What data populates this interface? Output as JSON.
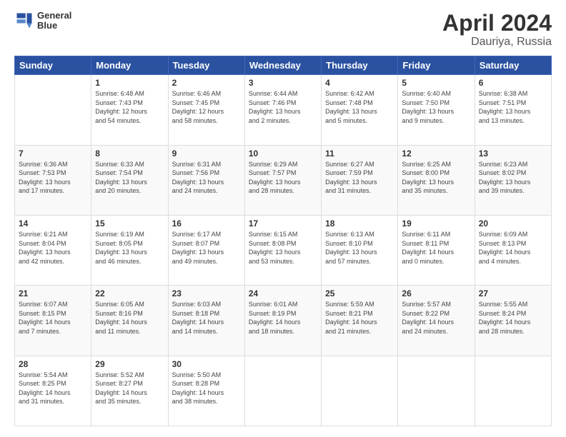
{
  "header": {
    "logo_line1": "General",
    "logo_line2": "Blue",
    "title": "April 2024",
    "subtitle": "Dauriya, Russia"
  },
  "days_of_week": [
    "Sunday",
    "Monday",
    "Tuesday",
    "Wednesday",
    "Thursday",
    "Friday",
    "Saturday"
  ],
  "weeks": [
    [
      {
        "num": "",
        "info": ""
      },
      {
        "num": "1",
        "info": "Sunrise: 6:48 AM\nSunset: 7:43 PM\nDaylight: 12 hours\nand 54 minutes."
      },
      {
        "num": "2",
        "info": "Sunrise: 6:46 AM\nSunset: 7:45 PM\nDaylight: 12 hours\nand 58 minutes."
      },
      {
        "num": "3",
        "info": "Sunrise: 6:44 AM\nSunset: 7:46 PM\nDaylight: 13 hours\nand 2 minutes."
      },
      {
        "num": "4",
        "info": "Sunrise: 6:42 AM\nSunset: 7:48 PM\nDaylight: 13 hours\nand 5 minutes."
      },
      {
        "num": "5",
        "info": "Sunrise: 6:40 AM\nSunset: 7:50 PM\nDaylight: 13 hours\nand 9 minutes."
      },
      {
        "num": "6",
        "info": "Sunrise: 6:38 AM\nSunset: 7:51 PM\nDaylight: 13 hours\nand 13 minutes."
      }
    ],
    [
      {
        "num": "7",
        "info": "Sunrise: 6:36 AM\nSunset: 7:53 PM\nDaylight: 13 hours\nand 17 minutes."
      },
      {
        "num": "8",
        "info": "Sunrise: 6:33 AM\nSunset: 7:54 PM\nDaylight: 13 hours\nand 20 minutes."
      },
      {
        "num": "9",
        "info": "Sunrise: 6:31 AM\nSunset: 7:56 PM\nDaylight: 13 hours\nand 24 minutes."
      },
      {
        "num": "10",
        "info": "Sunrise: 6:29 AM\nSunset: 7:57 PM\nDaylight: 13 hours\nand 28 minutes."
      },
      {
        "num": "11",
        "info": "Sunrise: 6:27 AM\nSunset: 7:59 PM\nDaylight: 13 hours\nand 31 minutes."
      },
      {
        "num": "12",
        "info": "Sunrise: 6:25 AM\nSunset: 8:00 PM\nDaylight: 13 hours\nand 35 minutes."
      },
      {
        "num": "13",
        "info": "Sunrise: 6:23 AM\nSunset: 8:02 PM\nDaylight: 13 hours\nand 39 minutes."
      }
    ],
    [
      {
        "num": "14",
        "info": "Sunrise: 6:21 AM\nSunset: 8:04 PM\nDaylight: 13 hours\nand 42 minutes."
      },
      {
        "num": "15",
        "info": "Sunrise: 6:19 AM\nSunset: 8:05 PM\nDaylight: 13 hours\nand 46 minutes."
      },
      {
        "num": "16",
        "info": "Sunrise: 6:17 AM\nSunset: 8:07 PM\nDaylight: 13 hours\nand 49 minutes."
      },
      {
        "num": "17",
        "info": "Sunrise: 6:15 AM\nSunset: 8:08 PM\nDaylight: 13 hours\nand 53 minutes."
      },
      {
        "num": "18",
        "info": "Sunrise: 6:13 AM\nSunset: 8:10 PM\nDaylight: 13 hours\nand 57 minutes."
      },
      {
        "num": "19",
        "info": "Sunrise: 6:11 AM\nSunset: 8:11 PM\nDaylight: 14 hours\nand 0 minutes."
      },
      {
        "num": "20",
        "info": "Sunrise: 6:09 AM\nSunset: 8:13 PM\nDaylight: 14 hours\nand 4 minutes."
      }
    ],
    [
      {
        "num": "21",
        "info": "Sunrise: 6:07 AM\nSunset: 8:15 PM\nDaylight: 14 hours\nand 7 minutes."
      },
      {
        "num": "22",
        "info": "Sunrise: 6:05 AM\nSunset: 8:16 PM\nDaylight: 14 hours\nand 11 minutes."
      },
      {
        "num": "23",
        "info": "Sunrise: 6:03 AM\nSunset: 8:18 PM\nDaylight: 14 hours\nand 14 minutes."
      },
      {
        "num": "24",
        "info": "Sunrise: 6:01 AM\nSunset: 8:19 PM\nDaylight: 14 hours\nand 18 minutes."
      },
      {
        "num": "25",
        "info": "Sunrise: 5:59 AM\nSunset: 8:21 PM\nDaylight: 14 hours\nand 21 minutes."
      },
      {
        "num": "26",
        "info": "Sunrise: 5:57 AM\nSunset: 8:22 PM\nDaylight: 14 hours\nand 24 minutes."
      },
      {
        "num": "27",
        "info": "Sunrise: 5:55 AM\nSunset: 8:24 PM\nDaylight: 14 hours\nand 28 minutes."
      }
    ],
    [
      {
        "num": "28",
        "info": "Sunrise: 5:54 AM\nSunset: 8:25 PM\nDaylight: 14 hours\nand 31 minutes."
      },
      {
        "num": "29",
        "info": "Sunrise: 5:52 AM\nSunset: 8:27 PM\nDaylight: 14 hours\nand 35 minutes."
      },
      {
        "num": "30",
        "info": "Sunrise: 5:50 AM\nSunset: 8:28 PM\nDaylight: 14 hours\nand 38 minutes."
      },
      {
        "num": "",
        "info": ""
      },
      {
        "num": "",
        "info": ""
      },
      {
        "num": "",
        "info": ""
      },
      {
        "num": "",
        "info": ""
      }
    ]
  ]
}
